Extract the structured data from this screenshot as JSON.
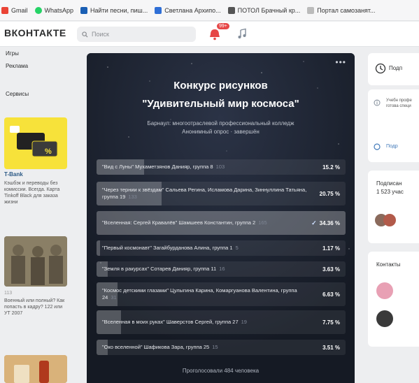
{
  "bookmarks": [
    {
      "label": "Gmail",
      "color": "#ea4335"
    },
    {
      "label": "WhatsApp",
      "color": "#25d366"
    },
    {
      "label": "Найти песни, пиш...",
      "color": "#1a5fb4"
    },
    {
      "label": "Светлана Архипо...",
      "color": "#2f6fd6"
    },
    {
      "label": "ПОТОЛ Брачный кр...",
      "color": "#555555"
    },
    {
      "label": "Портал самозанят...",
      "color": "#999999"
    }
  ],
  "header": {
    "logo": "ВКОНТАКТЕ",
    "search_placeholder": "Поиск",
    "notif_count": "99+"
  },
  "left": {
    "nav": [
      "Игры",
      "Реклама",
      "",
      "Сервисы"
    ],
    "ad1_title": "T-Bank",
    "ad1_text": "Кэшбэк и переводы без комиссии. Всегда. Карта Tinkoff Black для заказа жизни",
    "ad2_text": "Военный или полный? Как попасть в кадру? 122 или УТ 2007",
    "ad2_sub": "113"
  },
  "post": {
    "title_line1": "Конкурс рисунков",
    "title_line2": "\"Удивительный мир космоса\"",
    "subtitle": "Барнаул: многоотраслевой профессиональный колледж",
    "subtitle2": "Анонимный опрос · завершён",
    "voted": "Проголосовали 484 человека",
    "options": [
      {
        "text": "\"Вид с Луны\" Мухаметзянов Данияр, группа 8",
        "count": "103",
        "percent": "15.2 %",
        "value": 15.2,
        "voted": false
      },
      {
        "text": "\"Через тернии к звёздам\" Сальева Регина, Исламова Дарина, Зиннуллина Татьяна, группа 19",
        "count": "133",
        "percent": "20.75 %",
        "value": 20.75,
        "voted": false
      },
      {
        "text": "\"Вселенная: Сергей Кравалёв\" Шамшеев Константин, группа 2",
        "count": "165",
        "percent": "34.36 %",
        "value": 34.36,
        "voted": true
      },
      {
        "text": "\"Первый космонавт\" Загайбурданова Алина, группа 1",
        "count": "5",
        "percent": "1.17 %",
        "value": 1.17,
        "voted": false
      },
      {
        "text": "\"Земля в ракурсах\" Сотарев Данияр, группа 11",
        "count": "16",
        "percent": "3.63 %",
        "value": 3.63,
        "voted": false
      },
      {
        "text": "\"Космос детскими глазами\" Цулыгина Карина, Комаргуанова Валентина, группа 24",
        "count": "31",
        "percent": "6.63 %",
        "value": 6.63,
        "voted": false
      },
      {
        "text": "\"Вселенная в моих руках\" Шаверстов Сергей, группа 27",
        "count": "19",
        "percent": "7.75 %",
        "value": 7.75,
        "voted": false
      },
      {
        "text": "\"Око вселенной\" Шафикова Зара, группа 25",
        "count": "15",
        "percent": "3.51 %",
        "value": 3.51,
        "voted": false
      }
    ]
  },
  "right": {
    "subscribe_label": "Подп",
    "info_text": "Учебн профе готова специ",
    "info_link": "Подр",
    "subs_title": "Подписан",
    "subs_count": "1 523 учас",
    "contacts_title": "Контакты"
  }
}
